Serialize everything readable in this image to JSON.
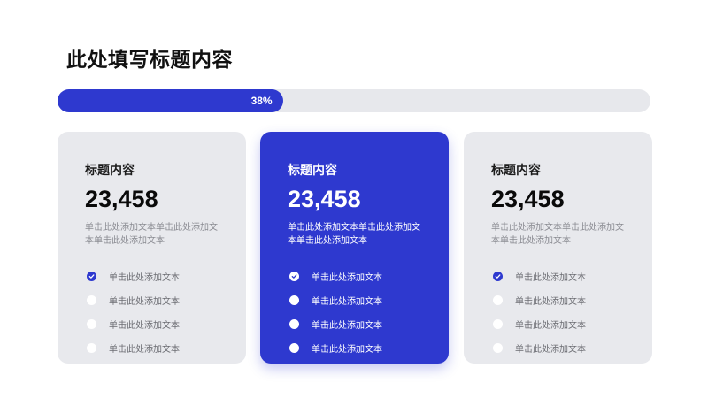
{
  "header": {
    "title": "此处填写标题内容"
  },
  "progress": {
    "value": 0.38,
    "label": "38%"
  },
  "colors": {
    "accent": "#2e39cf",
    "card_bg": "#e8e9ed",
    "track_bg": "#e7e8ec"
  },
  "cards": [
    {
      "heading": "标题内容",
      "number": "23,458",
      "desc": "单击此处添加文本单击此处添加文本单击此处添加文本",
      "items": [
        {
          "label": "单击此处添加文本",
          "checked": true
        },
        {
          "label": "单击此处添加文本",
          "checked": false
        },
        {
          "label": "单击此处添加文本",
          "checked": false
        },
        {
          "label": "单击此处添加文本",
          "checked": false
        }
      ]
    },
    {
      "heading": "标题内容",
      "number": "23,458",
      "desc": "单击此处添加文本单击此处添加文本单击此处添加文本",
      "items": [
        {
          "label": "单击此处添加文本",
          "checked": true
        },
        {
          "label": "单击此处添加文本",
          "checked": false
        },
        {
          "label": "单击此处添加文本",
          "checked": false
        },
        {
          "label": "单击此处添加文本",
          "checked": false
        }
      ]
    },
    {
      "heading": "标题内容",
      "number": "23,458",
      "desc": "单击此处添加文本单击此处添加文本单击此处添加文本",
      "items": [
        {
          "label": "单击此处添加文本",
          "checked": true
        },
        {
          "label": "单击此处添加文本",
          "checked": false
        },
        {
          "label": "单击此处添加文本",
          "checked": false
        },
        {
          "label": "单击此处添加文本",
          "checked": false
        }
      ]
    }
  ]
}
